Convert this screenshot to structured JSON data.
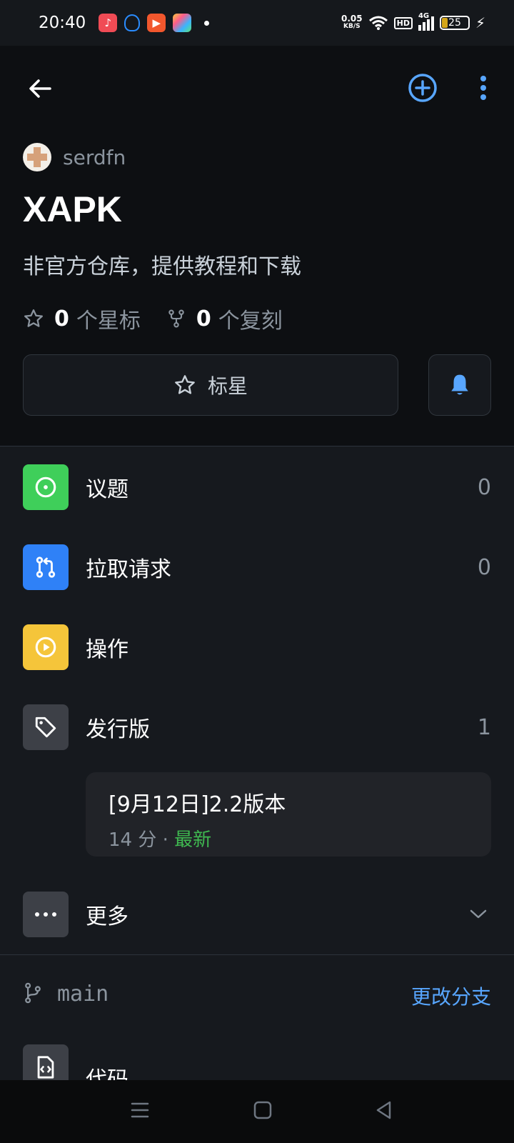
{
  "status_bar": {
    "time": "20:40",
    "net_speed_value": "0.05",
    "net_speed_unit": "KB/S",
    "hd": "HD",
    "network": "4G",
    "battery": "25"
  },
  "toolbar": {
    "back_icon": "arrow-left-icon",
    "add_icon": "plus-circle-icon",
    "more_icon": "kebab-icon"
  },
  "repo": {
    "owner": "serdfn",
    "name": "XAPK",
    "description": "非官方仓库，提供教程和下载",
    "stars_count": "0",
    "stars_label": "个星标",
    "forks_count": "0",
    "forks_label": "个复刻",
    "star_button": "标星"
  },
  "menu": {
    "items": [
      {
        "label": "议题",
        "count": "0",
        "icon": "issue-icon",
        "color": "#3fcf5a"
      },
      {
        "label": "拉取请求",
        "count": "0",
        "icon": "pull-request-icon",
        "color": "#2f81f7"
      },
      {
        "label": "操作",
        "count": "",
        "icon": "play-icon",
        "color": "#f5c53a"
      },
      {
        "label": "发行版",
        "count": "1",
        "icon": "tag-icon",
        "color": "#3d4047"
      },
      {
        "label": "更多",
        "count": "",
        "icon": "ellipsis-icon",
        "color": "#3d4047"
      }
    ]
  },
  "release": {
    "title": "[9月12日]2.2版本",
    "time": "14 分 · ",
    "status": "最新"
  },
  "branch": {
    "name": "main",
    "change_label": "更改分支"
  },
  "code": {
    "label": "代码"
  }
}
